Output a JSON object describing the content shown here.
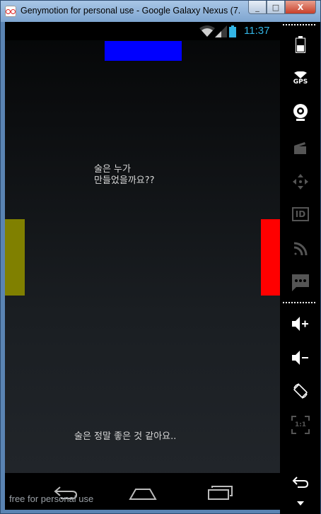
{
  "window": {
    "title": "Genymotion for personal use - Google Galaxy Nexus (7...",
    "controls": {
      "minimize": "_",
      "maximize": "□",
      "close": "X"
    }
  },
  "status_bar": {
    "time": "11:37",
    "icons": [
      "wifi-icon",
      "signal-icon",
      "battery-icon"
    ],
    "time_color": "#33b5e5"
  },
  "game": {
    "paddles": {
      "top_color": "#0000ff",
      "left_color": "#808000",
      "right_color": "#ff0000"
    },
    "center_message_line1": "술은 누가",
    "center_message_line2": "만들었을까요??",
    "bottom_message": "술은 정말 좋은 것 같아요.."
  },
  "nav_bar": {
    "buttons": [
      "back-icon",
      "home-icon",
      "recents-icon"
    ]
  },
  "watermark": "free for personal use",
  "sidebar": {
    "icons": [
      "battery-widget-icon",
      "gps-icon",
      "webcam-icon",
      "clapper-icon",
      "dpad-icon",
      "id-icon",
      "cast-icon",
      "sms-icon",
      "volume-up-icon",
      "volume-down-icon",
      "rotate-icon",
      "scale-icon",
      "back-icon",
      "menu-arrow-icon"
    ],
    "gps_label": "GPS",
    "id_label": "ID",
    "scale_label": "1:1"
  }
}
